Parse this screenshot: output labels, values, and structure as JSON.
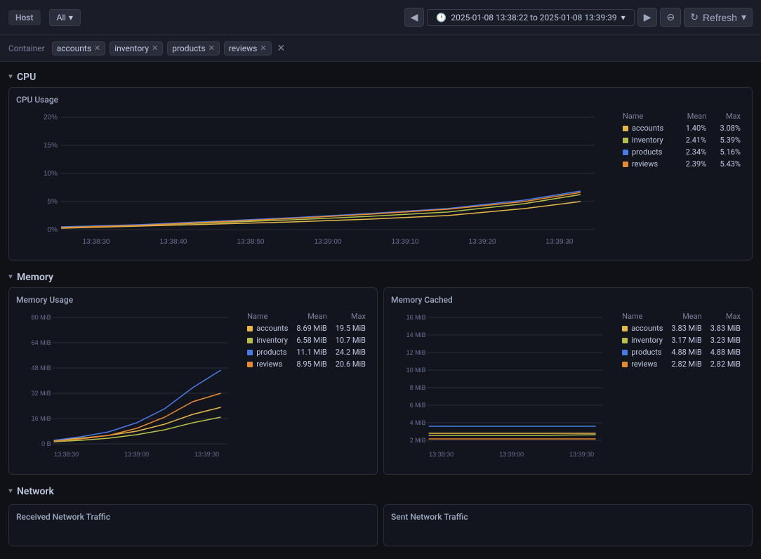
{
  "header": {
    "host_label": "Host",
    "all_label": "All",
    "time_range": "2025-01-08 13:38:22 to 2025-01-08 13:39:39",
    "refresh_label": "Refresh",
    "prev_icon": "◀",
    "next_icon": "▶",
    "zoom_icon": "⊖",
    "refresh_icon": "↻",
    "chevron_icon": "▾"
  },
  "filters": {
    "container_label": "Container",
    "tags": [
      "accounts",
      "inventory",
      "products",
      "reviews"
    ]
  },
  "cpu_section": {
    "label": "CPU",
    "chart_title": "CPU Usage",
    "y_labels": [
      "20%",
      "15%",
      "10%",
      "5%",
      "0%"
    ],
    "x_labels": [
      "13:38:30",
      "13:38:40",
      "13:38:50",
      "13:39:00",
      "13:39:10",
      "13:39:20",
      "13:39:30"
    ],
    "legend": {
      "headers": [
        "Name",
        "Mean",
        "Max"
      ],
      "rows": [
        {
          "name": "accounts",
          "color": "#e6b84a",
          "mean": "1.40%",
          "max": "3.08%"
        },
        {
          "name": "inventory",
          "color": "#b8c04a",
          "mean": "2.41%",
          "max": "5.39%"
        },
        {
          "name": "products",
          "color": "#4a7ae6",
          "mean": "2.34%",
          "max": "5.16%"
        },
        {
          "name": "reviews",
          "color": "#e68a2e",
          "mean": "2.39%",
          "max": "5.43%"
        }
      ]
    }
  },
  "memory_section": {
    "label": "Memory",
    "usage_chart": {
      "title": "Memory Usage",
      "y_labels": [
        "80 MiB",
        "64 MiB",
        "48 MiB",
        "32 MiB",
        "16 MiB",
        "0 B"
      ],
      "x_labels": [
        "13:38:30",
        "13:39:00",
        "13:39:30"
      ],
      "legend": {
        "headers": [
          "Name",
          "Mean",
          "Max"
        ],
        "rows": [
          {
            "name": "accounts",
            "color": "#e6b84a",
            "mean": "8.69 MiB",
            "max": "19.5 MiB"
          },
          {
            "name": "inventory",
            "color": "#b8c04a",
            "mean": "6.58 MiB",
            "max": "10.7 MiB"
          },
          {
            "name": "products",
            "color": "#4a7ae6",
            "mean": "11.1 MiB",
            "max": "24.2 MiB"
          },
          {
            "name": "reviews",
            "color": "#e68a2e",
            "mean": "8.95 MiB",
            "max": "20.6 MiB"
          }
        ]
      }
    },
    "cached_chart": {
      "title": "Memory Cached",
      "y_labels": [
        "16 MiB",
        "14 MiB",
        "12 MiB",
        "10 MiB",
        "8 MiB",
        "6 MiB",
        "4 MiB",
        "2 MiB"
      ],
      "x_labels": [
        "13:38:30",
        "13:39:00",
        "13:39:30"
      ],
      "legend": {
        "headers": [
          "Name",
          "Mean",
          "Max"
        ],
        "rows": [
          {
            "name": "accounts",
            "color": "#e6b84a",
            "mean": "3.83 MiB",
            "max": "3.83 MiB"
          },
          {
            "name": "inventory",
            "color": "#b8c04a",
            "mean": "3.17 MiB",
            "max": "3.23 MiB"
          },
          {
            "name": "products",
            "color": "#4a7ae6",
            "mean": "4.88 MiB",
            "max": "4.88 MiB"
          },
          {
            "name": "reviews",
            "color": "#e68a2e",
            "mean": "2.82 MiB",
            "max": "2.82 MiB"
          }
        ]
      }
    }
  },
  "network_section": {
    "label": "Network",
    "received_title": "Received Network Traffic",
    "sent_title": "Sent Network Traffic"
  }
}
